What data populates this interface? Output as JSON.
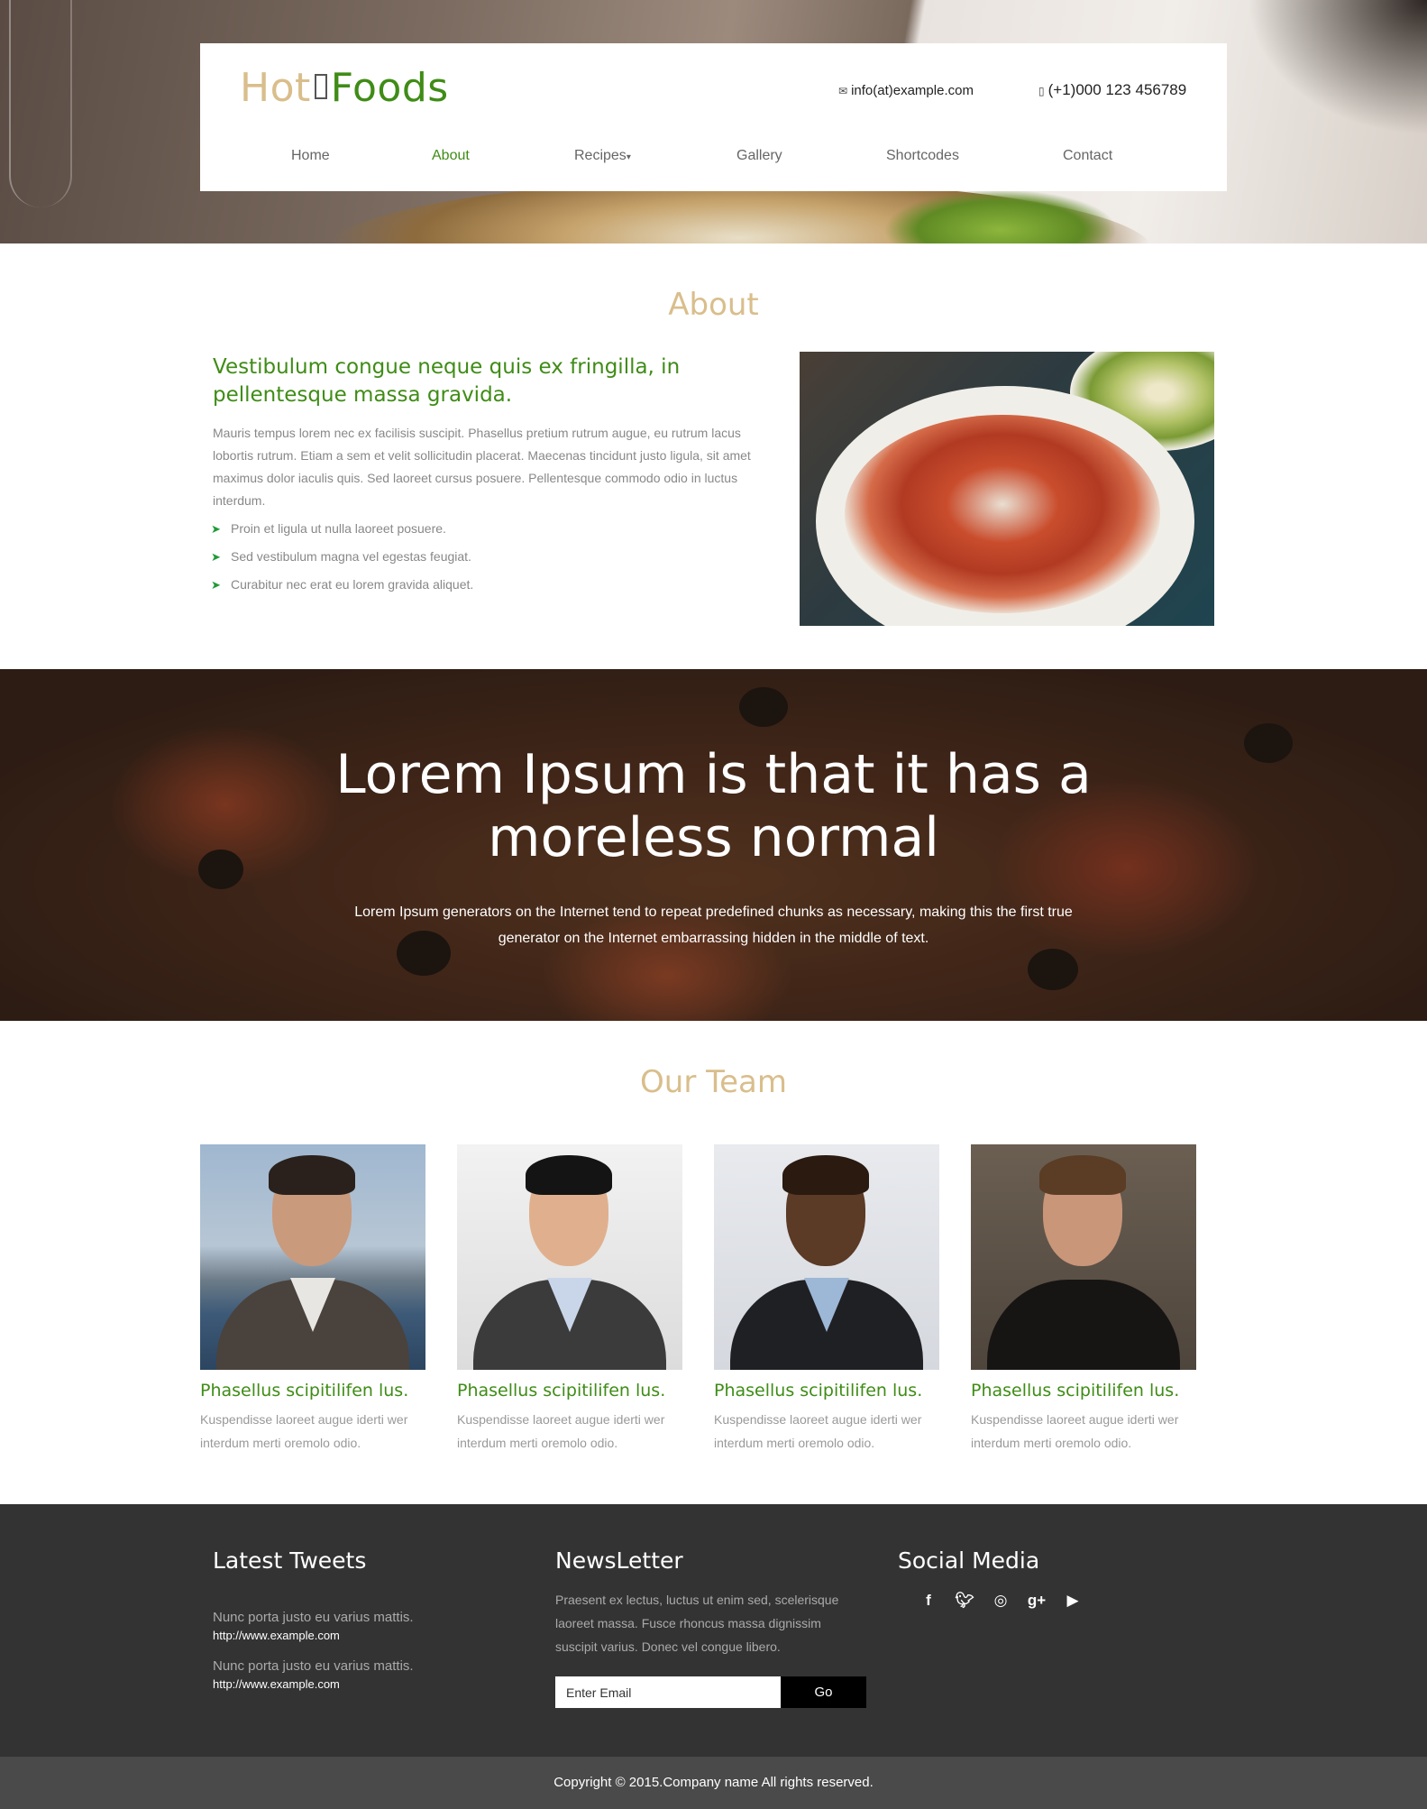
{
  "header": {
    "logo": {
      "hot": "Hot",
      "foods": "Foods"
    },
    "email": "info(at)example.com",
    "phone": "(+1)000 123 456789",
    "nav": [
      {
        "label": "Home"
      },
      {
        "label": "About",
        "active": true
      },
      {
        "label": "Recipes"
      },
      {
        "label": "Gallery"
      },
      {
        "label": "Shortcodes"
      },
      {
        "label": "Contact"
      }
    ]
  },
  "about": {
    "title": "About",
    "heading": "Vestibulum congue neque quis ex fringilla, in pellentesque massa gravida.",
    "text": "Mauris tempus lorem nec ex facilisis suscipit. Phasellus pretium rutrum augue, eu rutrum lacus lobortis rutrum. Etiam a sem et velit sollicitudin placerat. Maecenas tincidunt justo ligula, sit amet maximus dolor iaculis quis. Sed laoreet cursus posuere. Pellentesque commodo odio in luctus interdum.",
    "list": [
      "Proin et ligula ut nulla laoreet posuere.",
      "Sed vestibulum magna vel egestas feugiat.",
      "Curabitur nec erat eu lorem gravida aliquet."
    ]
  },
  "banner": {
    "title_line1": "Lorem Ipsum is that it has a",
    "title_line2": "moreless normal",
    "text": "Lorem Ipsum generators on the Internet tend to repeat predefined chunks as necessary, making this the first true generator on the Internet embarrassing hidden in the middle of text."
  },
  "team": {
    "title": "Our Team",
    "members": [
      {
        "name": "Phasellus scipitilifen lus.",
        "desc": "Kuspendisse laoreet augue iderti wer interdum merti oremolo odio."
      },
      {
        "name": "Phasellus scipitilifen lus.",
        "desc": "Kuspendisse laoreet augue iderti wer interdum merti oremolo odio."
      },
      {
        "name": "Phasellus scipitilifen lus.",
        "desc": "Kuspendisse laoreet augue iderti wer interdum merti oremolo odio."
      },
      {
        "name": "Phasellus scipitilifen lus.",
        "desc": "Kuspendisse laoreet augue iderti wer interdum merti oremolo odio."
      }
    ]
  },
  "footer": {
    "tweets_heading": "Latest Tweets",
    "tweets": [
      {
        "text": "Nunc porta justo eu varius mattis.",
        "link": "http://www.example.com"
      },
      {
        "text": "Nunc porta justo eu varius mattis.",
        "link": "http://www.example.com"
      }
    ],
    "newsletter_heading": "NewsLetter",
    "newsletter_text": "Praesent ex lectus, luctus ut enim sed, scelerisque laoreet massa. Fusce rhoncus massa dignissim suscipit varius. Donec vel congue libero.",
    "email_placeholder": "Enter Email",
    "go_label": "Go",
    "social_heading": "Social Media",
    "social_icons": [
      "facebook-icon",
      "twitter-icon",
      "dribbble-icon",
      "google-plus-icon",
      "youtube-icon"
    ],
    "copyright": "Copyright © 2015.Company name All rights reserved."
  },
  "colors": {
    "brand_green": "#3f8c16",
    "accent_gold": "#d9be8c",
    "footer_bg": "#333333"
  }
}
